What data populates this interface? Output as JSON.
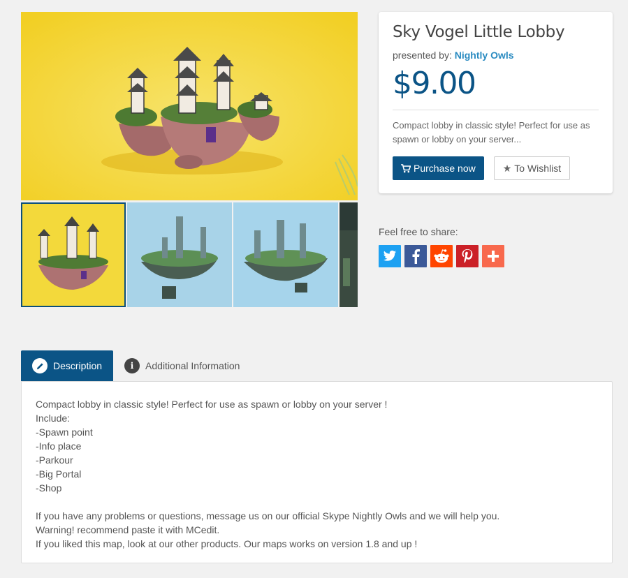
{
  "product": {
    "title": "Sky Vogel Little Lobby",
    "presented_prefix": "presented by:",
    "author": "Nightly Owls",
    "price": "$9.00",
    "summary": "Compact lobby in classic style! Perfect for use as spawn or lobby on your server...",
    "purchase_label": "Purchase now",
    "wishlist_label": "To Wishlist"
  },
  "colors": {
    "brand": "#0b5486",
    "link": "#2a8bc1",
    "twitter": "#1da1f2",
    "facebook": "#3b5998",
    "reddit": "#ff4500",
    "pinterest": "#cb2027",
    "addthis": "#f8694d"
  },
  "gallery": {
    "main_image_icon": "lobby-render-image",
    "thumbnails": [
      "lobby-yellow-thumb",
      "lobby-sky-thumb-1",
      "lobby-sky-thumb-2",
      "lobby-dark-thumb"
    ]
  },
  "share": {
    "label": "Feel free to share:",
    "buttons": [
      "twitter-icon",
      "facebook-icon",
      "reddit-icon",
      "pinterest-icon",
      "addthis-icon"
    ]
  },
  "tabs": [
    {
      "label": "Description",
      "icon": "pencil-icon",
      "active": true
    },
    {
      "label": "Additional Information",
      "icon": "info-icon",
      "active": false
    }
  ],
  "description": {
    "intro": "Compact lobby in classic style! Perfect for use as spawn or lobby on your server !",
    "include_label": "Include:",
    "includes": [
      "-Spawn point",
      "-Info place",
      "-Parkour",
      "-Big Portal",
      "-Shop"
    ],
    "paragraphs": [
      "If you have any problems or questions, message us on our official Skype Nightly Owls and we will help you.",
      "Warning! recommend paste it with MCedit.",
      "If you liked this map, look at our other products. Our maps works on version 1.8 and up !"
    ]
  }
}
